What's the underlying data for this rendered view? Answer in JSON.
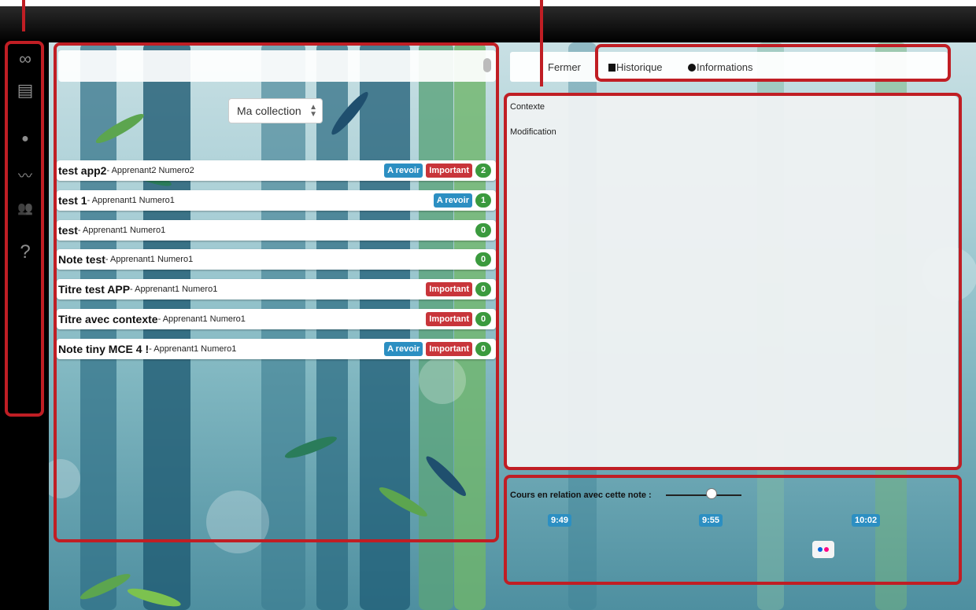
{
  "search": {
    "placeholder": ""
  },
  "collection_select": {
    "value": "Ma collection"
  },
  "sidebar": {
    "items": [
      {
        "icon": "infinity-icon",
        "glyph": "∞"
      },
      {
        "icon": "notes-icon",
        "glyph": "▤"
      },
      {
        "icon": "chat-icon",
        "glyph": "●"
      },
      {
        "icon": "chart-icon",
        "glyph": "〰"
      },
      {
        "icon": "users-icon",
        "glyph": "👥"
      },
      {
        "icon": "help-icon",
        "glyph": "?"
      }
    ]
  },
  "notes": [
    {
      "title": "test app2",
      "author": "- Apprenant2 Numero2",
      "revoir": "A revoir",
      "important": "Important",
      "count": "2"
    },
    {
      "title": "test 1",
      "author": "- Apprenant1 Numero1",
      "revoir": "A revoir",
      "important": "",
      "count": "1"
    },
    {
      "title": "test",
      "author": "- Apprenant1 Numero1",
      "revoir": "",
      "important": "",
      "count": "0"
    },
    {
      "title": "Note test",
      "author": "- Apprenant1 Numero1",
      "revoir": "",
      "important": "",
      "count": "0"
    },
    {
      "title": "Titre test APP",
      "author": "- Apprenant1 Numero1",
      "revoir": "",
      "important": "Important",
      "count": "0"
    },
    {
      "title": "Titre avec contexte",
      "author": "- Apprenant1 Numero1",
      "revoir": "",
      "important": "Important",
      "count": "0"
    },
    {
      "title": "Note tiny MCE 4 !",
      "author": "- Apprenant1 Numero1",
      "revoir": "A revoir",
      "important": "Important",
      "count": "0"
    }
  ],
  "tabs": {
    "fermer": "Fermer",
    "historique": "Historique",
    "informations": "Informations"
  },
  "details": {
    "contexte": "Contexte",
    "modification": "Modification"
  },
  "courses": {
    "label": "Cours en relation avec cette note :",
    "times": [
      "9:49",
      "9:55",
      "10:02"
    ]
  },
  "colors": {
    "annotation_red": "#c01e24",
    "badge_blue": "#2c8fc2",
    "badge_red": "#c8353a",
    "badge_green": "#3b9a3e"
  }
}
